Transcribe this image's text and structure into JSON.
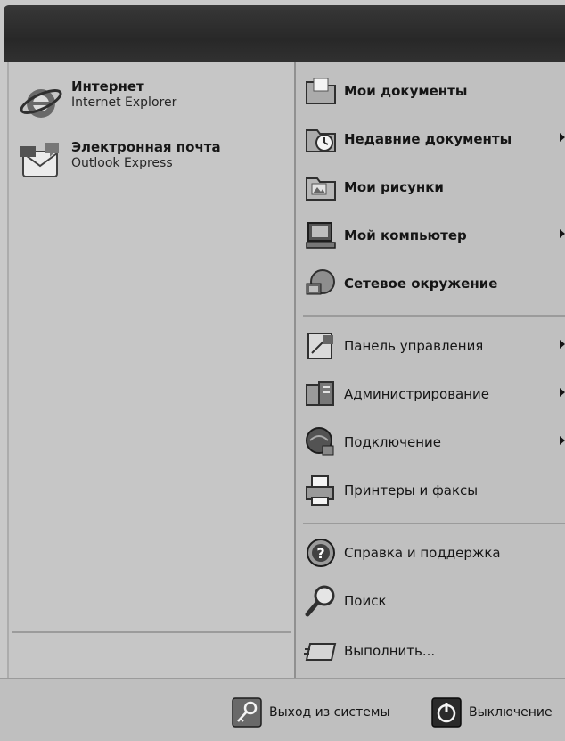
{
  "pinned": [
    {
      "title": "Интернет",
      "subtitle": "Internet Explorer",
      "icon": "internet-explorer-icon"
    },
    {
      "title": "Электронная почта",
      "subtitle": "Outlook Express",
      "icon": "outlook-express-icon"
    }
  ],
  "places": [
    {
      "label": "Мои документы",
      "icon": "my-documents-icon",
      "arrow": false
    },
    {
      "label": "Недавние документы",
      "icon": "recent-documents-icon",
      "arrow": true
    },
    {
      "label": "Мои рисунки",
      "icon": "my-pictures-icon",
      "arrow": false
    },
    {
      "label": "Мой компьютер",
      "icon": "my-computer-icon",
      "arrow": true
    },
    {
      "label": "Сетевое окружение",
      "icon": "network-places-icon",
      "arrow": false
    }
  ],
  "system": [
    {
      "label": "Панель управления",
      "icon": "control-panel-icon",
      "arrow": true
    },
    {
      "label": "Администрирование",
      "icon": "administrative-tools-icon",
      "arrow": true
    },
    {
      "label": "Подключение",
      "icon": "connect-to-icon",
      "arrow": true
    },
    {
      "label": "Принтеры и факсы",
      "icon": "printers-faxes-icon",
      "arrow": false
    }
  ],
  "tools": [
    {
      "label": "Справка и поддержка",
      "icon": "help-support-icon"
    },
    {
      "label": "Поиск",
      "icon": "search-icon"
    },
    {
      "label": "Выполнить...",
      "icon": "run-icon"
    }
  ],
  "footer": {
    "logoff": "Выход из системы",
    "shutdown": "Выключение"
  }
}
